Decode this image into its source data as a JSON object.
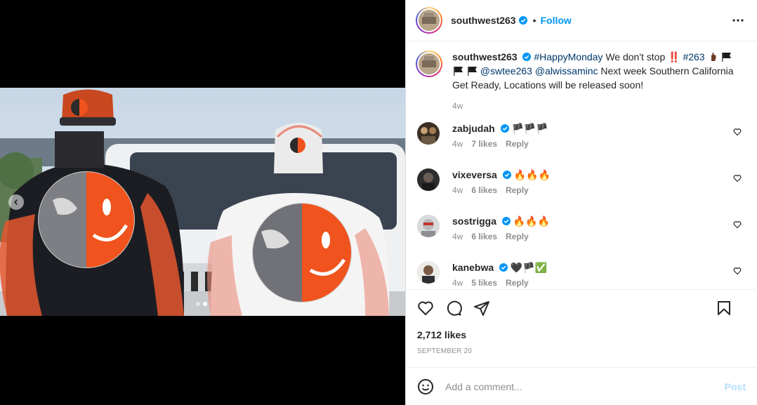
{
  "author": {
    "username": "southwest263",
    "verified": true,
    "follow_label": "Follow",
    "separator": "•"
  },
  "caption": {
    "username": "southwest263",
    "parts": [
      "#HappyMonday",
      "We don't stop ‼️",
      "#263",
      "@swtee263",
      "@alwissaminc",
      "Next week Southern California Get Ready, Locations will be released soon!"
    ],
    "time": "4w"
  },
  "comments": [
    {
      "username": "zabjudah",
      "text": "🏴🏴🏴",
      "time": "4w",
      "likes": "7 likes",
      "reply": "Reply"
    },
    {
      "username": "vixeversa",
      "text": "🔥🔥🔥",
      "time": "4w",
      "likes": "6 likes",
      "reply": "Reply"
    },
    {
      "username": "sostrigga",
      "text": "🔥🔥🔥",
      "time": "4w",
      "likes": "6 likes",
      "reply": "Reply"
    },
    {
      "username": "kanebwa",
      "text": "🖤🏴✅",
      "time": "4w",
      "likes": "5 likes",
      "reply": "Reply"
    }
  ],
  "stats": {
    "likes": "2,712 likes",
    "date": "SEPTEMBER 20"
  },
  "composer": {
    "placeholder": "Add a comment...",
    "post_label": "Post"
  },
  "carousel": {
    "total": 2,
    "active_index": 1
  },
  "icons": {
    "more": "more-horizontal-icon",
    "like": "heart-icon",
    "comment": "comment-icon",
    "share": "share-icon",
    "save": "bookmark-icon",
    "emoji": "emoji-icon",
    "prev": "chevron-left-icon"
  },
  "colors": {
    "accent": "#0095f6",
    "link": "#00376b",
    "muted": "#8e8e8e",
    "post_disabled": "#b2dffc",
    "jacket_orange": "#f0531d"
  }
}
